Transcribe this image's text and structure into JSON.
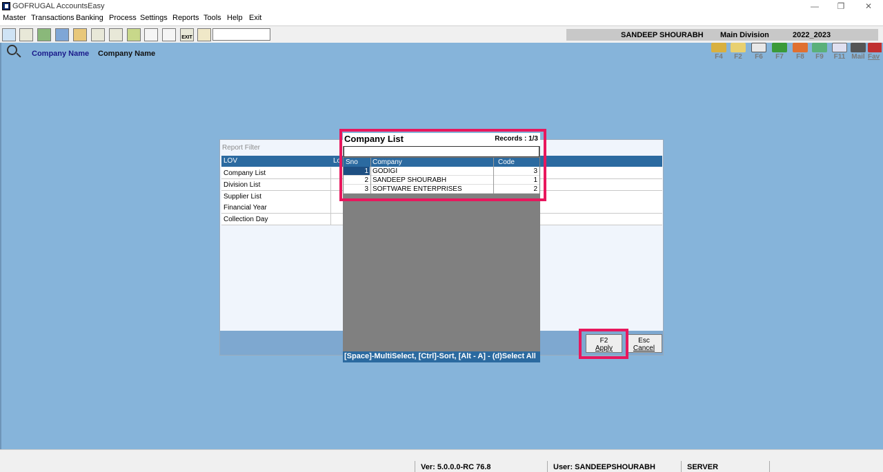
{
  "window": {
    "title": "GOFRUGAL AccountsEasy",
    "minimize": "—",
    "restore": "❐",
    "close": "✕"
  },
  "menu": [
    "Master",
    "Transactions",
    "Banking",
    "Process",
    "Settings",
    "Reports",
    "Tools",
    "Help",
    "Exit"
  ],
  "toolbar": {
    "icons": [
      "pencil-icon",
      "printer-icon",
      "ledger-icon",
      "contacts-icon",
      "folder-icon",
      "receipt-icon",
      "voucher-icon",
      "check-icon",
      "calculator-icon",
      "list-icon",
      "exit-icon",
      "bar-chart-icon"
    ],
    "exit_label": "EXIT",
    "search_value": ""
  },
  "session": {
    "user": "SANDEEP SHOURABH",
    "division": "Main Division",
    "year": "2022_2023"
  },
  "breadcrumb": {
    "label": "Company Name",
    "value": "Company Name"
  },
  "fkeys": [
    "F4",
    "F2",
    "F6",
    "F7",
    "F8",
    "F9",
    "F11",
    "Mail",
    "Fav"
  ],
  "report_filter": {
    "title": "Report Filter",
    "columns": [
      "LOV",
      "Lo"
    ],
    "rows": [
      "Company List",
      "Division List",
      "Supplier List",
      "Financial Year",
      "Collection Day"
    ],
    "apply_key": "F2",
    "apply_label": "Apply",
    "cancel_key": "Esc",
    "cancel_label": "Cancel"
  },
  "company_list": {
    "title": "Company List",
    "records": "Records : 1/3",
    "search_value": "",
    "columns": [
      "Sno",
      "Company",
      "Code"
    ],
    "rows": [
      {
        "sno": "1",
        "company": "GODIGI",
        "code": "3"
      },
      {
        "sno": "2",
        "company": "SANDEEP SHOURABH",
        "code": "1"
      },
      {
        "sno": "3",
        "company": "SOFTWARE ENTERPRISES",
        "code": "2"
      }
    ],
    "footer": "[Space]-MultiSelect, [Ctrl]-Sort, [Alt - A] - (d)Select All"
  },
  "status": {
    "version": "Ver: 5.0.0.0-RC 76.8",
    "user": "User: SANDEEPSHOURABH",
    "server": "SERVER"
  },
  "colors": {
    "workspace": "#86b4da",
    "header_blue": "#2b6aa0",
    "highlight": "#e8175d"
  }
}
